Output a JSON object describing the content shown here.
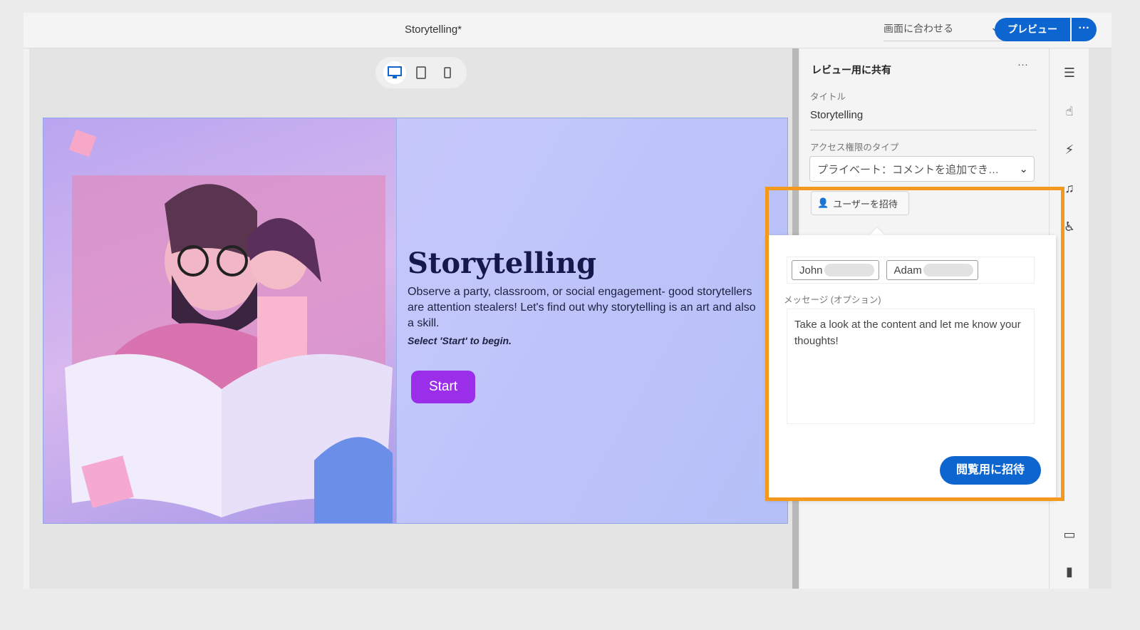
{
  "header": {
    "doc_title": "Storytelling*",
    "fit_label": "画面に合わせる",
    "preview_label": "プレビュー",
    "more_label": "···"
  },
  "devices": [
    {
      "icon": "desktop-icon",
      "active": true
    },
    {
      "icon": "tablet-icon"
    },
    {
      "icon": "phone-icon"
    }
  ],
  "slide": {
    "title": "Storytelling",
    "body": "Observe a party, classroom, or social engagement- good storytellers are attention stealers! Let's find out why storytelling is an art and also a skill.",
    "hint": "Select 'Start' to begin.",
    "start_label": "Start"
  },
  "panel": {
    "title": "レビュー用に共有",
    "more": "···",
    "title_label": "タイトル",
    "title_value": "Storytelling",
    "access_label": "アクセス権限のタイプ",
    "access_value": "プライベート：コメントを追加でき…",
    "invite_user_label": "ユーザーを招待"
  },
  "popup": {
    "recipients": [
      "John",
      "Adam"
    ],
    "message_label": "メッセージ (オプション)",
    "message": "Take a look at the content and let me know your thoughts!",
    "send_label": "閲覧用に招待"
  },
  "rail_icons": [
    "sliders-icon",
    "touch-icon",
    "interaction-icon",
    "music-icon",
    "accessibility-icon",
    "panel-icon",
    "document-icon"
  ],
  "colors": {
    "accent": "#0d66d0",
    "highlight": "#f39a1e",
    "start": "#9b2ee8"
  }
}
